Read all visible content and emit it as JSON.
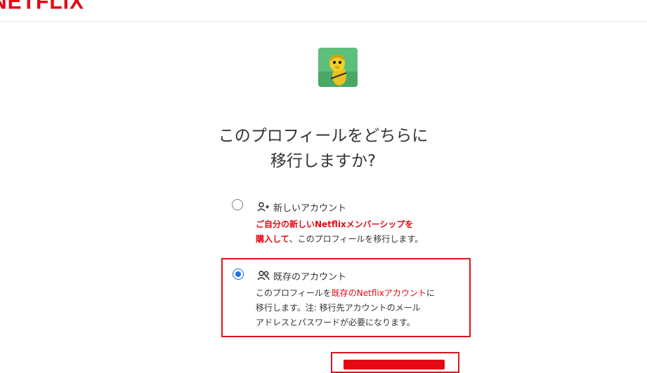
{
  "header": {
    "logo_text": "NETFLIX"
  },
  "profile": {
    "avatar_icon": "profile-avatar-image"
  },
  "question": {
    "line1": "このプロフィールをどちらに",
    "line2": "移行しますか?"
  },
  "options": {
    "new_account": {
      "title": "新しいアカウント",
      "icon": "add-person-icon",
      "desc_line1_red": "ご自分の新しいNetflixメンバーシップを",
      "desc_line2_red": "購入して",
      "desc_line2_rest": "、このプロフィールを移行します。",
      "selected": false
    },
    "existing_account": {
      "title": "既存のアカウント",
      "icon": "people-icon",
      "desc_line1_pre": "このプロフィールを",
      "desc_line1_red": "既存のNetflixアカウント",
      "desc_line1_post": "に",
      "desc_line2": "移行します。注: 移行先アカウントのメール",
      "desc_line3": "アドレスとパスワードが必要になります。",
      "selected": true
    }
  },
  "colors": {
    "brand": "#e50914",
    "radio_selected": "#1a73e8",
    "highlight": "#d9151c"
  }
}
